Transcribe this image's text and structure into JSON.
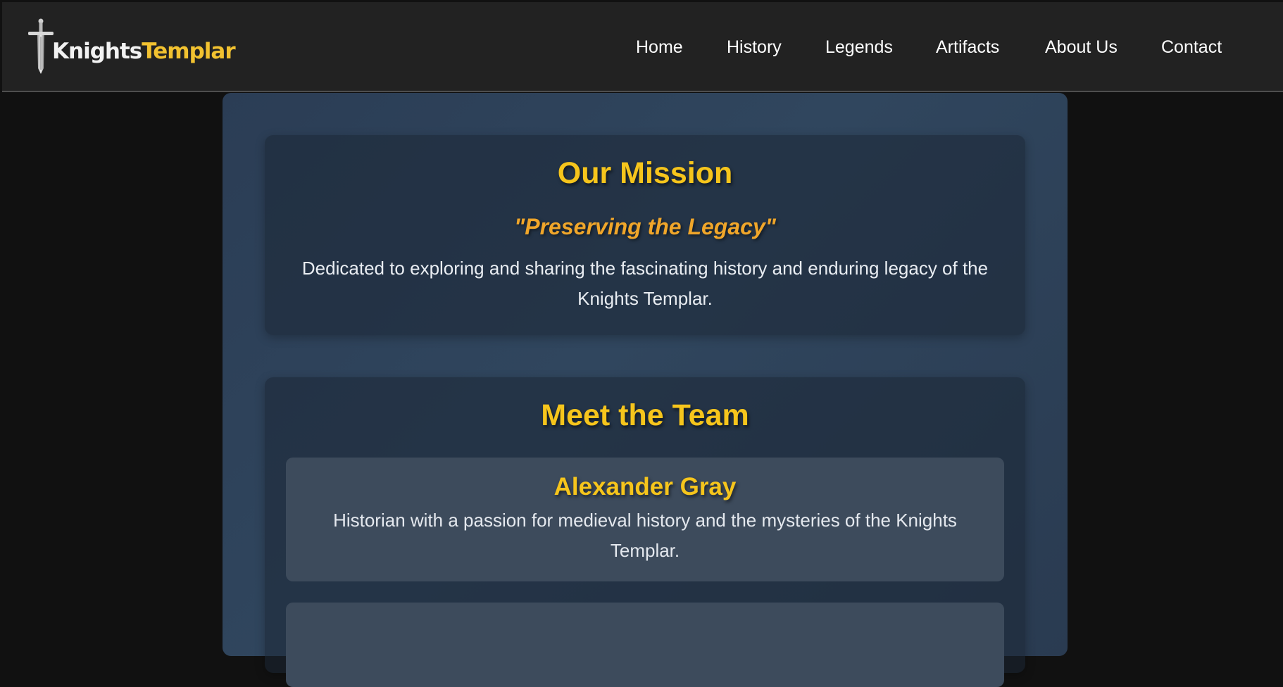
{
  "logo": {
    "text_primary": "Knights",
    "text_accent": "Templar",
    "icon": "sword-icon"
  },
  "nav": {
    "items": [
      {
        "label": "Home"
      },
      {
        "label": "History"
      },
      {
        "label": "Legends"
      },
      {
        "label": "Artifacts"
      },
      {
        "label": "About Us"
      },
      {
        "label": "Contact"
      }
    ]
  },
  "mission": {
    "title": "Our Mission",
    "quote": "\"Preserving the Legacy\"",
    "description": "Dedicated to exploring and sharing the fascinating history and enduring legacy of the Knights Templar."
  },
  "team": {
    "title": "Meet the Team",
    "members": [
      {
        "name": "Alexander Gray",
        "bio": "Historian with a passion for medieval history and the mysteries of the Knights Templar."
      }
    ]
  },
  "colors": {
    "accent_gold": "#f6c51c",
    "accent_orange": "#f0a62a",
    "nav_background": "#222222",
    "page_background": "#111111",
    "panel_background": "#2e435b"
  }
}
